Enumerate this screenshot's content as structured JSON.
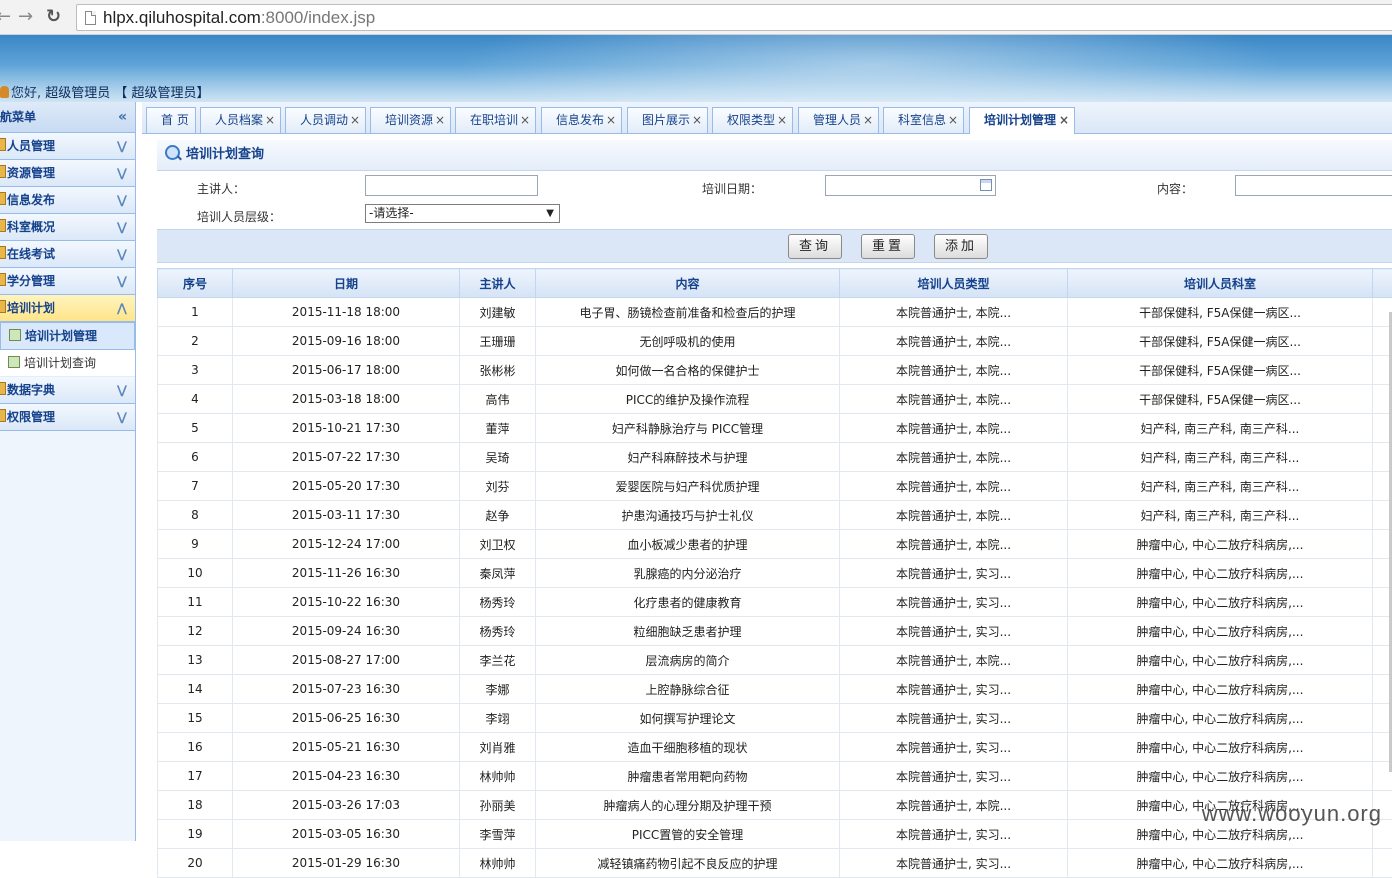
{
  "browser": {
    "url_host": "hlpx.qiluhospital.com",
    "url_rest": ":8000/index.jsp"
  },
  "header": {
    "hello": "您好,",
    "user_text": "超级管理员 【 超级管理员】"
  },
  "sidebar": {
    "title": "航菜单",
    "groups": [
      {
        "label": "人员管理"
      },
      {
        "label": "资源管理"
      },
      {
        "label": "信息发布"
      },
      {
        "label": "科室概况"
      },
      {
        "label": "在线考试"
      },
      {
        "label": "学分管理"
      },
      {
        "label": "培训计划"
      },
      {
        "label": "数据字典"
      },
      {
        "label": "权限管理"
      }
    ],
    "sub_items": [
      {
        "label": "培训计划管理"
      },
      {
        "label": "培训计划查询"
      }
    ]
  },
  "tabs": [
    {
      "label": "首 页"
    },
    {
      "label": "人员档案"
    },
    {
      "label": "人员调动"
    },
    {
      "label": "培训资源"
    },
    {
      "label": "在职培训"
    },
    {
      "label": "信息发布"
    },
    {
      "label": "图片展示"
    },
    {
      "label": "权限类型"
    },
    {
      "label": "管理人员"
    },
    {
      "label": "科室信息"
    },
    {
      "label": "培训计划管理"
    }
  ],
  "panel": {
    "title": "培训计划查询",
    "speaker_label": "主讲人：",
    "date_label": "培训日期：",
    "content_label": "内容：",
    "level_label": "培训人员层级：",
    "level_value": "-请选择-",
    "query_btn": "查询",
    "reset_btn": "重置",
    "add_btn": "添加"
  },
  "table": {
    "headers": [
      "序号",
      "日期",
      "主讲人",
      "内容",
      "培训人员类型",
      "培训人员科室"
    ],
    "rows": [
      [
        "1",
        "2015-11-18 18:00",
        "刘建敏",
        "电子胃、肠镜检查前准备和检查后的护理",
        "本院普通护士, 本院...",
        "干部保健科, F5A保健一病区..."
      ],
      [
        "2",
        "2015-09-16 18:00",
        "王珊珊",
        "无创呼吸机的使用",
        "本院普通护士, 本院...",
        "干部保健科, F5A保健一病区..."
      ],
      [
        "3",
        "2015-06-17 18:00",
        "张彬彬",
        "如何做一名合格的保健护士",
        "本院普通护士, 本院...",
        "干部保健科, F5A保健一病区..."
      ],
      [
        "4",
        "2015-03-18 18:00",
        "高伟",
        "PICC的维护及操作流程",
        "本院普通护士, 本院...",
        "干部保健科, F5A保健一病区..."
      ],
      [
        "5",
        "2015-10-21 17:30",
        "董萍",
        "妇产科静脉治疗与 PICC管理",
        "本院普通护士, 本院...",
        "妇产科, 南三产科, 南三产科..."
      ],
      [
        "6",
        "2015-07-22 17:30",
        "吴琦",
        "妇产科麻醉技术与护理",
        "本院普通护士, 本院...",
        "妇产科, 南三产科, 南三产科..."
      ],
      [
        "7",
        "2015-05-20 17:30",
        "刘芬",
        "爱婴医院与妇产科优质护理",
        "本院普通护士, 本院...",
        "妇产科, 南三产科, 南三产科..."
      ],
      [
        "8",
        "2015-03-11 17:30",
        "赵争",
        "护患沟通技巧与护士礼仪",
        "本院普通护士, 本院...",
        "妇产科, 南三产科, 南三产科..."
      ],
      [
        "9",
        "2015-12-24 17:00",
        "刘卫权",
        "血小板减少患者的护理",
        "本院普通护士, 本院...",
        "肿瘤中心, 中心二放疗科病房,..."
      ],
      [
        "10",
        "2015-11-26 16:30",
        "秦凤萍",
        "乳腺癌的内分泌治疗",
        "本院普通护士, 实习...",
        "肿瘤中心, 中心二放疗科病房,..."
      ],
      [
        "11",
        "2015-10-22 16:30",
        "杨秀玲",
        "化疗患者的健康教育",
        "本院普通护士, 实习...",
        "肿瘤中心, 中心二放疗科病房,..."
      ],
      [
        "12",
        "2015-09-24 16:30",
        "杨秀玲",
        "粒细胞缺乏患者护理",
        "本院普通护士, 实习...",
        "肿瘤中心, 中心二放疗科病房,..."
      ],
      [
        "13",
        "2015-08-27 17:00",
        "李兰花",
        "层流病房的简介",
        "本院普通护士, 本院...",
        "肿瘤中心, 中心二放疗科病房,..."
      ],
      [
        "14",
        "2015-07-23 16:30",
        "李娜",
        "上腔静脉综合征",
        "本院普通护士, 实习...",
        "肿瘤中心, 中心二放疗科病房,..."
      ],
      [
        "15",
        "2015-06-25 16:30",
        "李翊",
        "如何撰写护理论文",
        "本院普通护士, 实习...",
        "肿瘤中心, 中心二放疗科病房,..."
      ],
      [
        "16",
        "2015-05-21 16:30",
        "刘肖雅",
        "造血干细胞移植的现状",
        "本院普通护士, 实习...",
        "肿瘤中心, 中心二放疗科病房,..."
      ],
      [
        "17",
        "2015-04-23 16:30",
        "林帅帅",
        "肿瘤患者常用靶向药物",
        "本院普通护士, 实习...",
        "肿瘤中心, 中心二放疗科病房,..."
      ],
      [
        "18",
        "2015-03-26 17:03",
        "孙丽美",
        "肿瘤病人的心理分期及护理干预",
        "本院普通护士, 本院...",
        "肿瘤中心, 中心二放疗科病房,..."
      ],
      [
        "19",
        "2015-03-05 16:30",
        "李雪萍",
        "PICC置管的安全管理",
        "本院普通护士, 实习...",
        "肿瘤中心, 中心二放疗科病房,..."
      ],
      [
        "20",
        "2015-01-29 16:30",
        "林帅帅",
        "减轻镇痛药物引起不良反应的护理",
        "本院普通护士, 实习...",
        "肿瘤中心, 中心二放疗科病房,..."
      ]
    ]
  },
  "watermark": "www.wooyun.org"
}
